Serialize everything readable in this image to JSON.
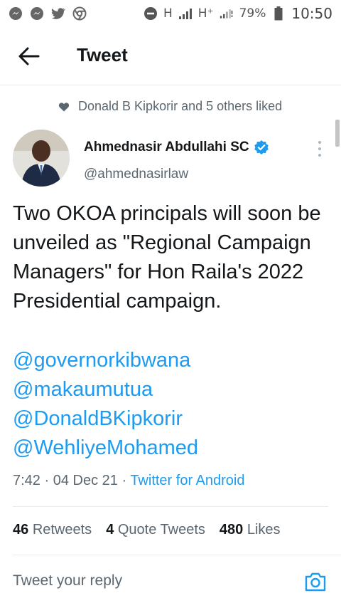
{
  "status_bar": {
    "network_h1": "H",
    "network_h2": "H⁺",
    "battery": "79%",
    "time": "10:50"
  },
  "header": {
    "title": "Tweet"
  },
  "social_context": {
    "text": "Donald B Kipkorir and 5 others liked"
  },
  "tweet": {
    "author_name": "Ahmednasir Abdullahi SC",
    "author_handle": "@ahmednasirlaw",
    "text": "Two OKOA principals will soon be unveiled as \"Regional Campaign Managers\" for Hon Raila's 2022 Presidential campaign.",
    "mentions": [
      "@governorkibwana",
      "@makaumutua",
      "@DonaldBKipkorir",
      "@WehliyeMohamed"
    ],
    "time": "7:42",
    "date": "04 Dec 21",
    "source": "Twitter for Android"
  },
  "stats": {
    "retweets_count": "46",
    "retweets_label": "Retweets",
    "quotes_count": "4",
    "quotes_label": "Quote Tweets",
    "likes_count": "480",
    "likes_label": "Likes"
  },
  "reply": {
    "placeholder": "Tweet your reply"
  },
  "colors": {
    "link": "#1d9bf0",
    "text": "#14171a",
    "secondary": "#5b6770",
    "divider": "#e6ecf0"
  }
}
